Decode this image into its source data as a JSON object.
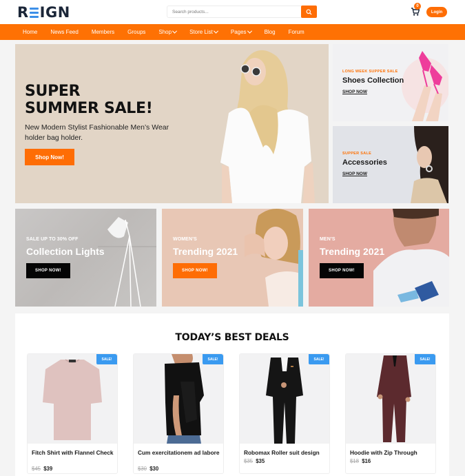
{
  "brand": {
    "logo_left": "R",
    "logo_right": "IGN",
    "accent": "#fe7104",
    "logo_color": "#1b2638",
    "logo_bar_color": "#3d8fe8"
  },
  "header": {
    "search_placeholder": "Search products...",
    "cart_count": "0",
    "login_label": "Login"
  },
  "nav": {
    "items": [
      {
        "label": "Home",
        "has_dropdown": false
      },
      {
        "label": "News Feed",
        "has_dropdown": false
      },
      {
        "label": "Members",
        "has_dropdown": false
      },
      {
        "label": "Groups",
        "has_dropdown": false
      },
      {
        "label": "Shop",
        "has_dropdown": true
      },
      {
        "label": "Store List",
        "has_dropdown": true
      },
      {
        "label": "Pages",
        "has_dropdown": true
      },
      {
        "label": "Blog",
        "has_dropdown": false
      },
      {
        "label": "Forum",
        "has_dropdown": false
      }
    ]
  },
  "hero": {
    "title_line1": "SUPER",
    "title_line2": "SUMMER SALE!",
    "subtitle": "New Modern Stylist Fashionable Men’s Wear holder bag holder.",
    "button": "Shop Now!"
  },
  "side_banners": [
    {
      "kicker": "LONG WEEK SUPPER SALE",
      "title": "Shoes Collection",
      "link": "SHOP NOW"
    },
    {
      "kicker": "SUPPER SALE",
      "title": "Accessories",
      "link": "SHOP NOW"
    }
  ],
  "tiles": [
    {
      "kicker": "SALE UP TO 30% OFF",
      "title": "Collection Lights",
      "button": "SHOP NOW!"
    },
    {
      "kicker": "WOMEN’S",
      "title": "Trending 2021",
      "button": "SHOP NOW!"
    },
    {
      "kicker": "MEN’S",
      "title": "Trending 2021",
      "button": "SHOP NOW!"
    }
  ],
  "deals": {
    "title": "TODAY’S BEST DEALS",
    "products": [
      {
        "badge": "SALE!",
        "name": "Fitch Shirt with Flannel Check",
        "old_price": "$45",
        "price": "$39"
      },
      {
        "badge": "SALE!",
        "name": "Cum exercitationem ad labore",
        "old_price": "$30",
        "price": "$30"
      },
      {
        "badge": "SALE!",
        "name": "Robomax Roller suit design",
        "old_price": "$35",
        "price": "$35"
      },
      {
        "badge": "SALE!",
        "name": "Hoodie with Zip Through",
        "old_price": "$18",
        "price": "$16"
      }
    ]
  }
}
